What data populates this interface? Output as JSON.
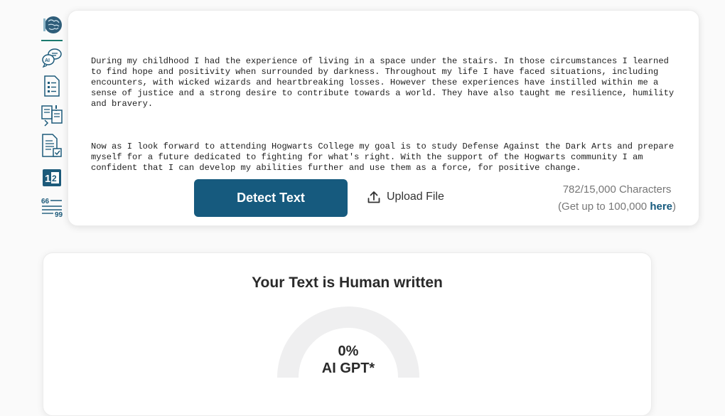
{
  "sidebar": {
    "items": [
      {
        "icon": "brain-icon"
      },
      {
        "icon": "ai-chat-icon"
      },
      {
        "icon": "document-list-icon"
      },
      {
        "icon": "compare-icon"
      },
      {
        "icon": "document-check-icon"
      },
      {
        "icon": "number-icon"
      },
      {
        "icon": "quote-icon"
      }
    ]
  },
  "editor": {
    "paragraphs": [
      "During my childhood I had the experience of living in a space under the stairs. In those circumstances I learned to find hope and positivity when surrounded by darkness. Throughout my life I have faced situations, including encounters, with wicked wizards and heartbreaking losses. However these experiences have instilled within me a sense of justice and a strong desire to contribute towards a world. They have also taught me resilience, humility and bravery.",
      "Now as I look forward to attending Hogwarts College my goal is to study Defense Against the Dark Arts and prepare myself for a future dedicated to fighting for what's right. With the support of the Hogwarts community I am confident that I can develop my abilities further and use them as a force, for positive change."
    ]
  },
  "actions": {
    "detect_label": "Detect Text",
    "upload_label": "Upload File"
  },
  "char_count": {
    "count": "782/15,000 Characters",
    "upgrade_prefix": "(Get up to 100,000 ",
    "upgrade_link": "here",
    "upgrade_suffix": ")"
  },
  "result": {
    "title": "Your Text is Human written",
    "percent": "0%",
    "label": "AI GPT*",
    "value": 0
  },
  "colors": {
    "accent": "#165a7e",
    "active_line": "#1b7a6e",
    "gauge_track": "#efeff0"
  }
}
